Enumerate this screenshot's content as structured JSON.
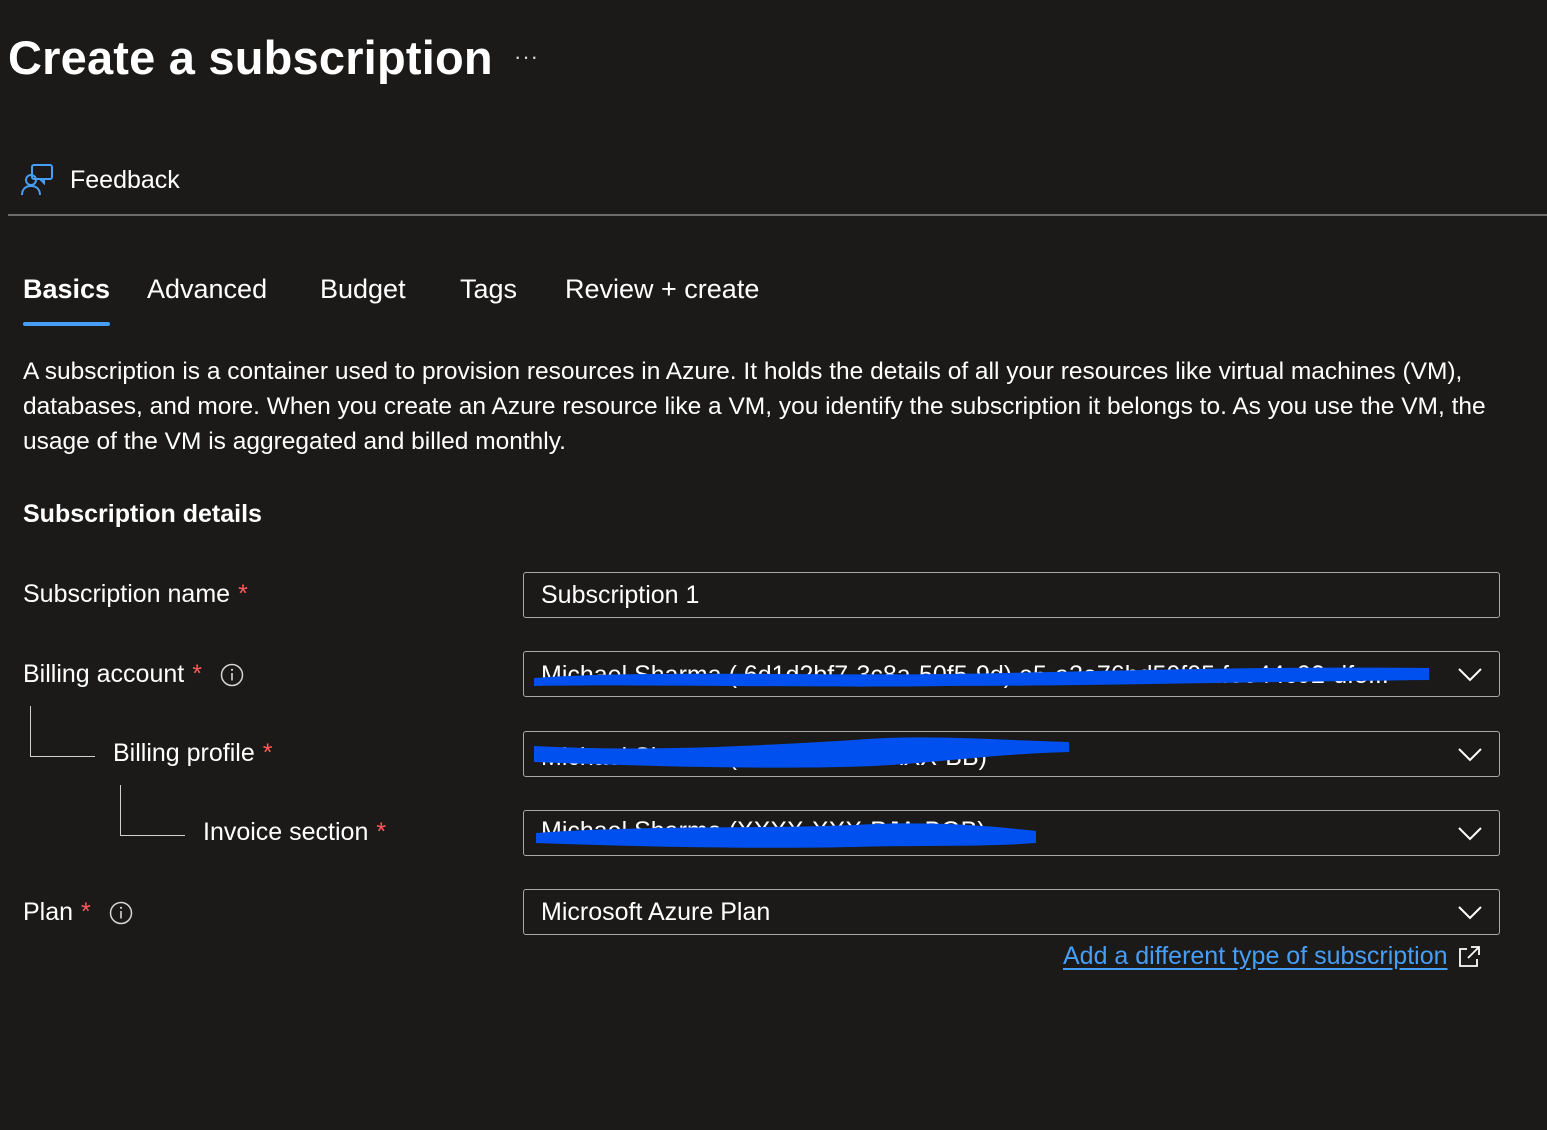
{
  "page": {
    "title": "Create a subscription",
    "more_label": "···"
  },
  "toolbar": {
    "feedback_label": "Feedback",
    "feedback_icon": "feedback-person-icon"
  },
  "tabs": [
    {
      "label": "Basics",
      "active": true
    },
    {
      "label": "Advanced",
      "active": false
    },
    {
      "label": "Budget",
      "active": false
    },
    {
      "label": "Tags",
      "active": false
    },
    {
      "label": "Review + create",
      "active": false
    }
  ],
  "description": "A subscription is a container used to provision resources in Azure. It holds the details of all your resources like virtual machines (VM), databases, and more. When you create an Azure resource like a VM, you identify the subscription it belongs to. As you use the VM, the usage of the VM is aggregated and billed monthly.",
  "section": {
    "heading": "Subscription details"
  },
  "fields": {
    "subscription_name": {
      "label": "Subscription name",
      "required": "*",
      "value": "Subscription 1"
    },
    "billing_account": {
      "label": "Billing account",
      "required": "*",
      "value_redacted": true
    },
    "billing_profile": {
      "label": "Billing profile",
      "required": "*",
      "value_redacted": true
    },
    "invoice_section": {
      "label": "Invoice section",
      "required": "*",
      "value_redacted": true
    },
    "plan": {
      "label": "Plan",
      "required": "*",
      "value": "Microsoft Azure Plan"
    }
  },
  "link": {
    "label": "Add a different type of subscription",
    "icon": "open-external-icon"
  },
  "colors": {
    "background": "#1b1a19",
    "text": "#ffffff",
    "accent": "#479ef5",
    "required": "#ff5a5a",
    "border": "#a8a8a8",
    "redaction": "#0050f0"
  }
}
